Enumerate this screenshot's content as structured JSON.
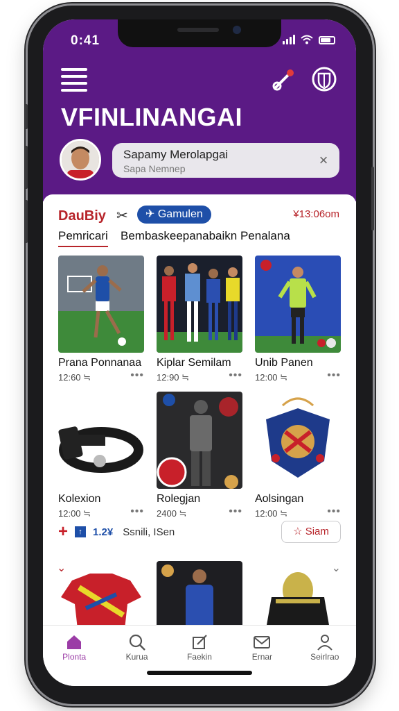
{
  "status_bar": {
    "time": "0:41"
  },
  "header": {
    "title": "VFINLINANGAI",
    "search": {
      "title": "Sapamy Merolapgai",
      "placeholder": "Sapa Nemnep"
    }
  },
  "content": {
    "brand": "DauBiy",
    "pill_label": "Gamulen",
    "price": "¥13:06om",
    "tabs": [
      "Pemricari",
      "Bembaskeepanabaikn Penalana"
    ],
    "items": [
      {
        "name": "Prana Ponnanaa",
        "time": "12:60 ≒"
      },
      {
        "name": "Kiplar Semilam",
        "time": "12:90 ≒"
      },
      {
        "name": "Unib Panen",
        "time": "12:00 ≒"
      },
      {
        "name": "Kolexion",
        "time": "12:00 ≒"
      },
      {
        "name": "Rolegjan",
        "time": "2400 ≒"
      },
      {
        "name": "Aolsingan",
        "time": "12:00 ≒"
      }
    ],
    "row_bar": {
      "count": "1.2¥",
      "text": "Ssnili, ISen"
    },
    "siam_button": "Siam"
  },
  "bottom_nav": [
    {
      "label": "Plonta",
      "icon": "home-icon",
      "active": true
    },
    {
      "label": "Kurua",
      "icon": "search-icon",
      "active": false
    },
    {
      "label": "Faekin",
      "icon": "edit-icon",
      "active": false
    },
    {
      "label": "Ernar",
      "icon": "mail-icon",
      "active": false
    },
    {
      "label": "Seirlrao",
      "icon": "profile-icon",
      "active": false
    }
  ],
  "colors": {
    "header": "#5b1a85",
    "brand_red": "#b7242a",
    "pill_blue": "#1e4fa8",
    "active_nav": "#9b3ca6"
  }
}
